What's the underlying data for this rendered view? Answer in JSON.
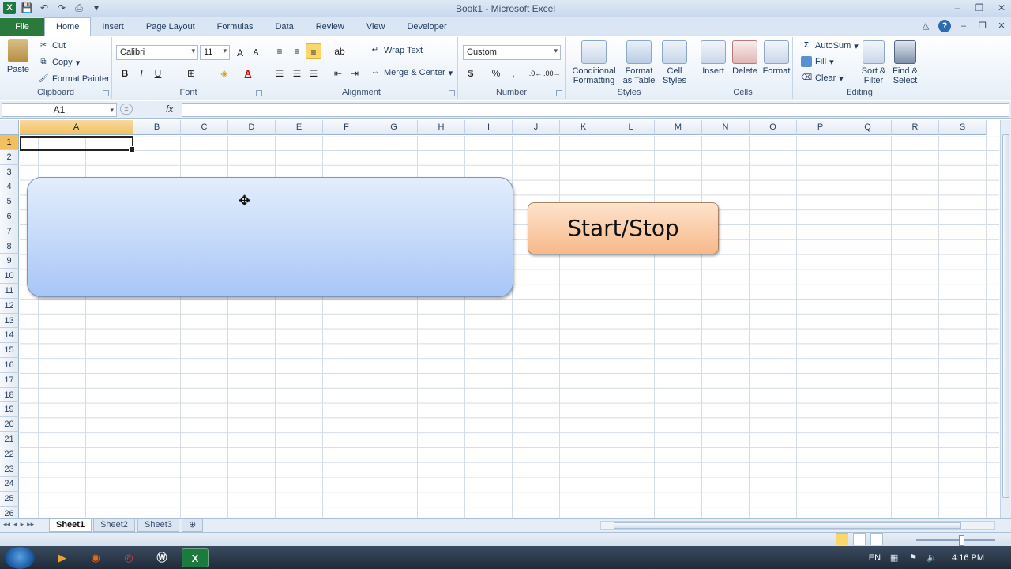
{
  "window": {
    "title": "Book1 - Microsoft Excel"
  },
  "tabs": [
    "File",
    "Home",
    "Insert",
    "Page Layout",
    "Formulas",
    "Data",
    "Review",
    "View",
    "Developer"
  ],
  "ribbon": {
    "clipboard": {
      "label": "Clipboard",
      "paste": "Paste",
      "cut": "Cut",
      "copy": "Copy",
      "format_painter": "Format Painter"
    },
    "font": {
      "label": "Font",
      "family": "Calibri",
      "size": "11",
      "bold": "B",
      "italic": "I",
      "underline": "U"
    },
    "alignment": {
      "label": "Alignment",
      "wrap_text": "Wrap Text",
      "merge_center": "Merge & Center"
    },
    "number": {
      "label": "Number",
      "format": "Custom",
      "currency": "$",
      "percent": "%",
      "comma": ","
    },
    "styles": {
      "label": "Styles",
      "conditional": "Conditional\nFormatting",
      "format_table": "Format\nas Table",
      "cell_styles": "Cell\nStyles"
    },
    "cells": {
      "label": "Cells",
      "insert": "Insert",
      "delete": "Delete",
      "format": "Format"
    },
    "editing": {
      "label": "Editing",
      "autosum": "AutoSum",
      "fill": "Fill",
      "clear": "Clear",
      "sort_filter": "Sort &\nFilter",
      "find_select": "Find &\nSelect"
    }
  },
  "formula_bar": {
    "name_box": "A1",
    "fx": "fx",
    "value": ""
  },
  "grid": {
    "columns": [
      "A",
      "B",
      "C",
      "D",
      "E",
      "F",
      "G",
      "H",
      "I",
      "J",
      "K",
      "L",
      "M",
      "N",
      "O",
      "P",
      "Q",
      "R",
      "S"
    ],
    "rows": [
      "1",
      "2",
      "3",
      "4",
      "5",
      "6",
      "7",
      "8",
      "9",
      "10",
      "11",
      "12",
      "13",
      "14",
      "15",
      "16",
      "17",
      "18",
      "19",
      "20",
      "21",
      "22",
      "23",
      "24",
      "25",
      "26"
    ],
    "selected_column": "A",
    "selected_row": "1"
  },
  "shapes": {
    "start_stop_label": "Start/Stop"
  },
  "sheets": [
    "Sheet1",
    "Sheet2",
    "Sheet3"
  ],
  "active_sheet": "Sheet1",
  "taskbar": {
    "lang": "EN",
    "time": "4:16 PM",
    "excel_label": "X"
  }
}
